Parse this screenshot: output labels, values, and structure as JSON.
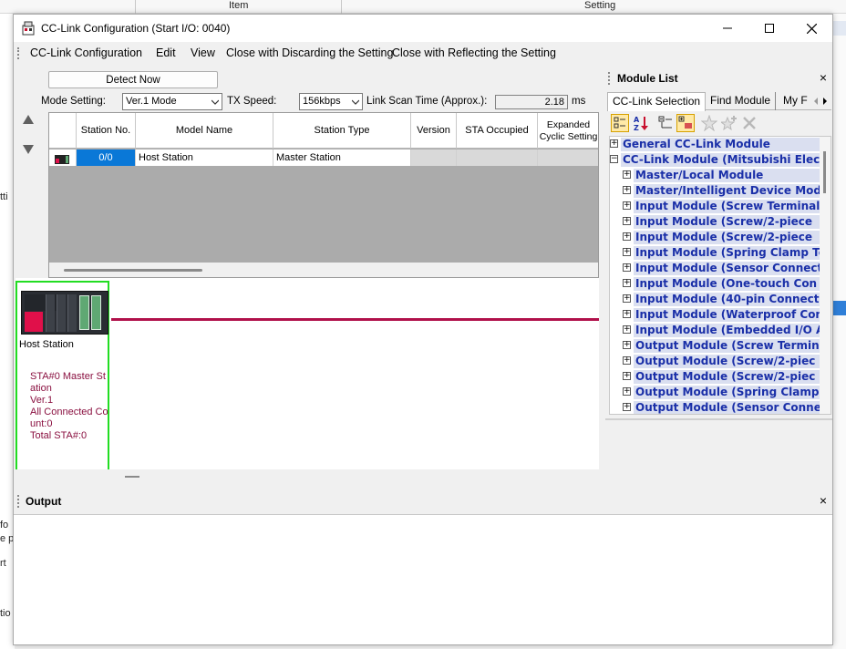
{
  "background": {
    "header_item": "Item",
    "header_setting": "Setting",
    "left_fragments": [
      "tti",
      "fo",
      "e p",
      "rt",
      "tio"
    ]
  },
  "window": {
    "title": "CC-Link Configuration (Start I/O: 0040)"
  },
  "menu": {
    "items": [
      "CC-Link Configuration",
      "Edit",
      "View",
      "Close with Discarding the Setting",
      "Close with Reflecting the Setting"
    ]
  },
  "controls": {
    "detect_now": "Detect Now",
    "mode_label": "Mode Setting:",
    "mode_value": "Ver.1 Mode",
    "speed_label": "TX Speed:",
    "speed_value": "156kbps",
    "scan_label": "Link Scan Time (Approx.):",
    "scan_value": "2.18",
    "scan_unit": "ms"
  },
  "grid": {
    "columns": [
      "Station No.",
      "Model Name",
      "Station Type",
      "Version",
      "STA Occupied",
      "Expanded Cyclic Setting"
    ],
    "rows": [
      {
        "station_no": "0/0",
        "model": "Host Station",
        "type": "Master Station",
        "version": "",
        "occupied": "",
        "expanded": ""
      }
    ]
  },
  "diagram": {
    "host_label": "Host Station",
    "sta_info": [
      "STA#0  Master St",
      "ation",
      "Ver.1",
      "All Connected Co",
      "unt:0",
      "Total STA#:0"
    ]
  },
  "module_list": {
    "title": "Module List",
    "close": "×",
    "tabs": [
      "CC-Link Selection",
      "Find Module",
      "My F"
    ],
    "tree": [
      {
        "label": "General CC-Link Module",
        "level": 0,
        "expander": "+"
      },
      {
        "label": "CC-Link Module (Mitsubishi Electric)",
        "level": 0,
        "expander": "−"
      },
      {
        "label": "Master/Local Module",
        "level": 1,
        "expander": "+"
      },
      {
        "label": "Master/Intelligent Device Module",
        "level": 1,
        "expander": "+"
      },
      {
        "label": "Input Module (Screw Terminal)",
        "level": 1,
        "expander": "+"
      },
      {
        "label": "Input Module (Screw/2-piece",
        "level": 1,
        "expander": "+"
      },
      {
        "label": "Input Module (Screw/2-piece",
        "level": 1,
        "expander": "+"
      },
      {
        "label": "Input Module (Spring Clamp Te",
        "level": 1,
        "expander": "+"
      },
      {
        "label": "Input Module (Sensor Connect",
        "level": 1,
        "expander": "+"
      },
      {
        "label": "Input Module (One-touch Con",
        "level": 1,
        "expander": "+"
      },
      {
        "label": "Input Module (40-pin Connect",
        "level": 1,
        "expander": "+"
      },
      {
        "label": "Input Module (Waterproof Con",
        "level": 1,
        "expander": "+"
      },
      {
        "label": "Input Module (Embedded I/O A",
        "level": 1,
        "expander": "+"
      },
      {
        "label": "Output Module (Screw Termin",
        "level": 1,
        "expander": "+"
      },
      {
        "label": "Output Module (Screw/2-piec",
        "level": 1,
        "expander": "+"
      },
      {
        "label": "Output Module (Screw/2-piec",
        "level": 1,
        "expander": "+"
      },
      {
        "label": "Output Module (Spring Clamp",
        "level": 1,
        "expander": "+"
      },
      {
        "label": "Output Module (Sensor Conne",
        "level": 1,
        "expander": "+"
      }
    ]
  },
  "output": {
    "title": "Output",
    "close": "×"
  },
  "colors": {
    "selection": "#0a78d7",
    "bus_line": "#b0104a",
    "host_frame": "#22dd22",
    "tree_text": "#1a2fa8",
    "sta_info_text": "#8a1040"
  }
}
